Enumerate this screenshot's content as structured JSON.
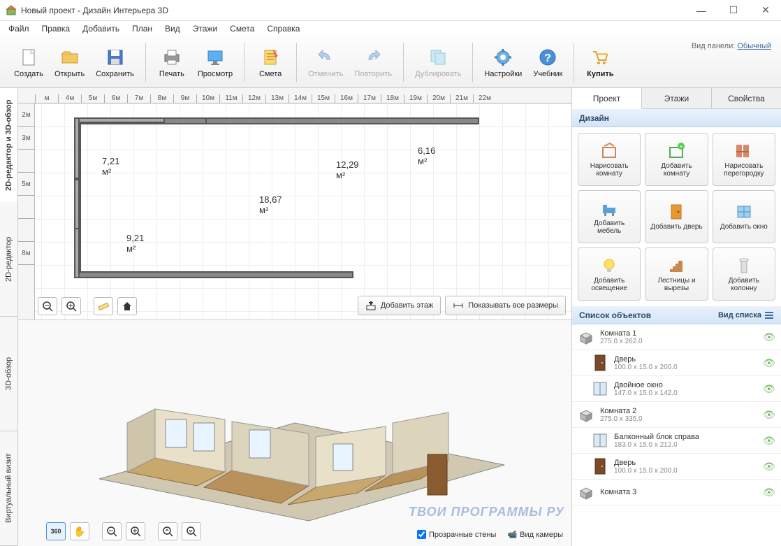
{
  "window": {
    "title": "Новый проект - Дизайн Интерьера 3D"
  },
  "menu": [
    "Файл",
    "Правка",
    "Добавить",
    "План",
    "Вид",
    "Этажи",
    "Смета",
    "Справка"
  ],
  "toolbar": {
    "create": "Создать",
    "open": "Открыть",
    "save": "Сохранить",
    "print": "Печать",
    "preview": "Просмотр",
    "estimate": "Смета",
    "undo": "Отменить",
    "redo": "Повторить",
    "duplicate": "Дублировать",
    "settings": "Настройки",
    "tutorial": "Учебник",
    "buy": "Купить",
    "panel_label": "Вид панели:",
    "panel_value": "Обычный"
  },
  "sidetabs": [
    "2D-редактор и 3D-обзор",
    "2D-редактор",
    "3D-обзор",
    "Виртуальный визит"
  ],
  "ruler_h": [
    "м",
    "4м",
    "5м",
    "6м",
    "7м",
    "8м",
    "9м",
    "10м",
    "11м",
    "12м",
    "13м",
    "14м",
    "15м",
    "16м",
    "17м",
    "18м",
    "19м",
    "20м",
    "21м",
    "22м"
  ],
  "ruler_v": [
    "2м",
    "3м",
    "",
    "5м",
    "",
    "",
    "8м"
  ],
  "rooms": {
    "r1": "7,21 м²",
    "r2": "18,67 м²",
    "r3": "12,29 м²",
    "r4": "6,16 м²",
    "r5": "9,21 м²"
  },
  "plan_buttons": {
    "add_floor": "Добавить этаж",
    "show_dims": "Показывать все размеры"
  },
  "bottom": {
    "transparent_walls": "Прозрачные стены",
    "camera_view": "Вид камеры"
  },
  "rightpanel": {
    "tabs": [
      "Проект",
      "Этажи",
      "Свойства"
    ],
    "design_section": "Дизайн",
    "buttons": [
      {
        "label": "Нарисовать комнату"
      },
      {
        "label": "Добавить комнату"
      },
      {
        "label": "Нарисовать перегородку"
      },
      {
        "label": "Добавить мебель"
      },
      {
        "label": "Добавить дверь"
      },
      {
        "label": "Добавить окно"
      },
      {
        "label": "Добавить освещение"
      },
      {
        "label": "Лестницы и вырезы"
      },
      {
        "label": "Добавить колонну"
      }
    ],
    "objects_section": "Список объектов",
    "list_view": "Вид списка",
    "objects": [
      {
        "title": "Комната 1",
        "dims": "275.0 x 262.0",
        "type": "room"
      },
      {
        "title": "Дверь",
        "dims": "100.0 x 15.0 x 200.0",
        "type": "door",
        "child": true
      },
      {
        "title": "Двойное окно",
        "dims": "147.0 x 15.0 x 142.0",
        "type": "window",
        "child": true
      },
      {
        "title": "Комната 2",
        "dims": "275.0 x 335.0",
        "type": "room"
      },
      {
        "title": "Балконный блок справа",
        "dims": "183.0 x 15.0 x 212.0",
        "type": "window",
        "child": true
      },
      {
        "title": "Дверь",
        "dims": "100.0 x 15.0 x 200.0",
        "type": "door",
        "child": true
      },
      {
        "title": "Комната 3",
        "dims": "",
        "type": "room"
      }
    ]
  },
  "watermark": "ТВОИ ПРОГРАММЫ РУ"
}
